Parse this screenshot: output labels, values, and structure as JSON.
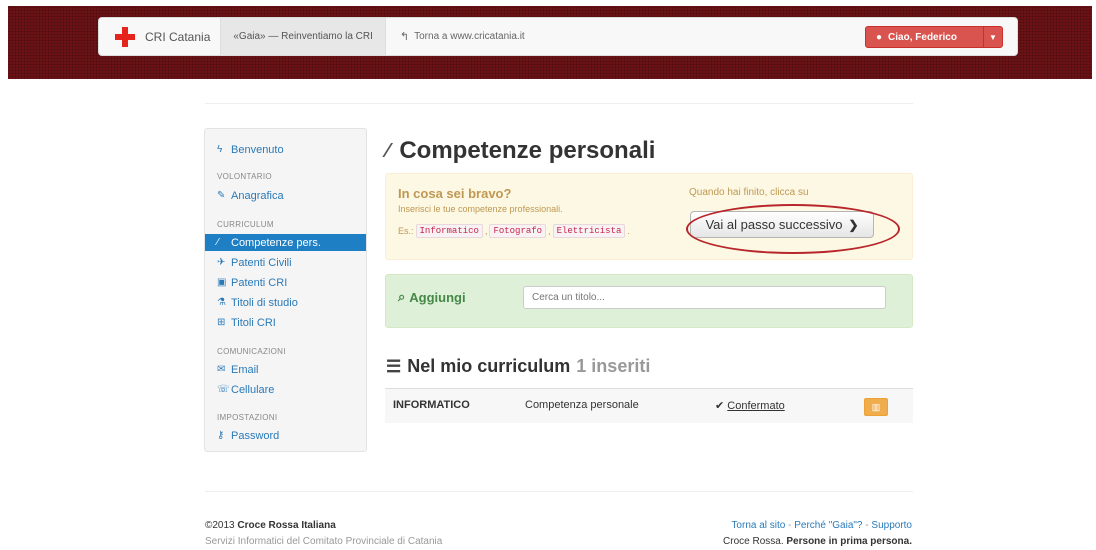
{
  "navbar": {
    "brand": "CRI Catania",
    "active_tab": "«Gaia» — Reinventiamo la CRI",
    "back_link": "Torna a www.cricatania.it",
    "user_button": "Ciao, Federico"
  },
  "sidebar": {
    "welcome": "Benvenuto",
    "sections": {
      "volontario": "VOLONTARIO",
      "curriculum": "CURRICULUM",
      "comunicazioni": "COMUNICAZIONI",
      "impostazioni": "IMPOSTAZIONI"
    },
    "items": {
      "anagrafica": "Anagrafica",
      "competenze": "Competenze pers.",
      "patenti_civili": "Patenti Civili",
      "patenti_cri": "Patenti CRI",
      "titoli_studio": "Titoli di studio",
      "titoli_cri": "Titoli CRI",
      "email": "Email",
      "cellulare": "Cellulare",
      "password": "Password"
    }
  },
  "main": {
    "title": "Competenze personali",
    "prompt": {
      "question": "In cosa sei bravo?",
      "subtitle": "Inserisci le tue competenze professionali.",
      "examples_prefix": "Es.:",
      "examples": [
        "Informatico",
        "Fotografo",
        "Elettricista"
      ],
      "done_label": "Quando hai finito, clicca su",
      "next_button": "Vai al passo successivo"
    },
    "add": {
      "label": "Aggiungi",
      "placeholder": "Cerca un titolo..."
    },
    "curriculum": {
      "title": "Nel mio curriculum",
      "count": "1 inseriti",
      "rows": [
        {
          "name": "INFORMATICO",
          "type": "Competenza personale",
          "status": "Confermato"
        }
      ]
    }
  },
  "footer": {
    "copyright_year": "©2013",
    "org": "Croce Rossa Italiana",
    "subtitle": "Servizi Informatici del Comitato Provinciale di Catania",
    "links": [
      "Torna al sito",
      "Perché \"Gaia\"?",
      "Supporto"
    ],
    "link_sep": "-",
    "tagline_prefix": "Croce Rossa.",
    "tagline_bold": "Persone in prima persona."
  },
  "colors": {
    "topband": "#6b1216",
    "accent_blue": "#1f7fc4",
    "danger": "#d9534f",
    "warning_bg": "#fcf8e3",
    "success_bg": "#dff0d8",
    "highlight_ellipse": "#b8262b"
  },
  "icons": {
    "brand": "red-cross-icon",
    "back": "reply-icon",
    "user": "user-icon",
    "welcome": "bolt-icon",
    "anagrafica": "edit-icon",
    "competenze": "magic-wand-icon",
    "patenti_civili": "plane-icon",
    "patenti_cri": "ambulance-icon",
    "titoli_studio": "beaker-icon",
    "titoli_cri": "plus-square-icon",
    "email": "envelope-icon",
    "cellulare": "phone-icon",
    "password": "key-icon",
    "add": "search-icon",
    "list": "list-icon",
    "confirmed": "check-icon",
    "delete": "trash-icon"
  }
}
